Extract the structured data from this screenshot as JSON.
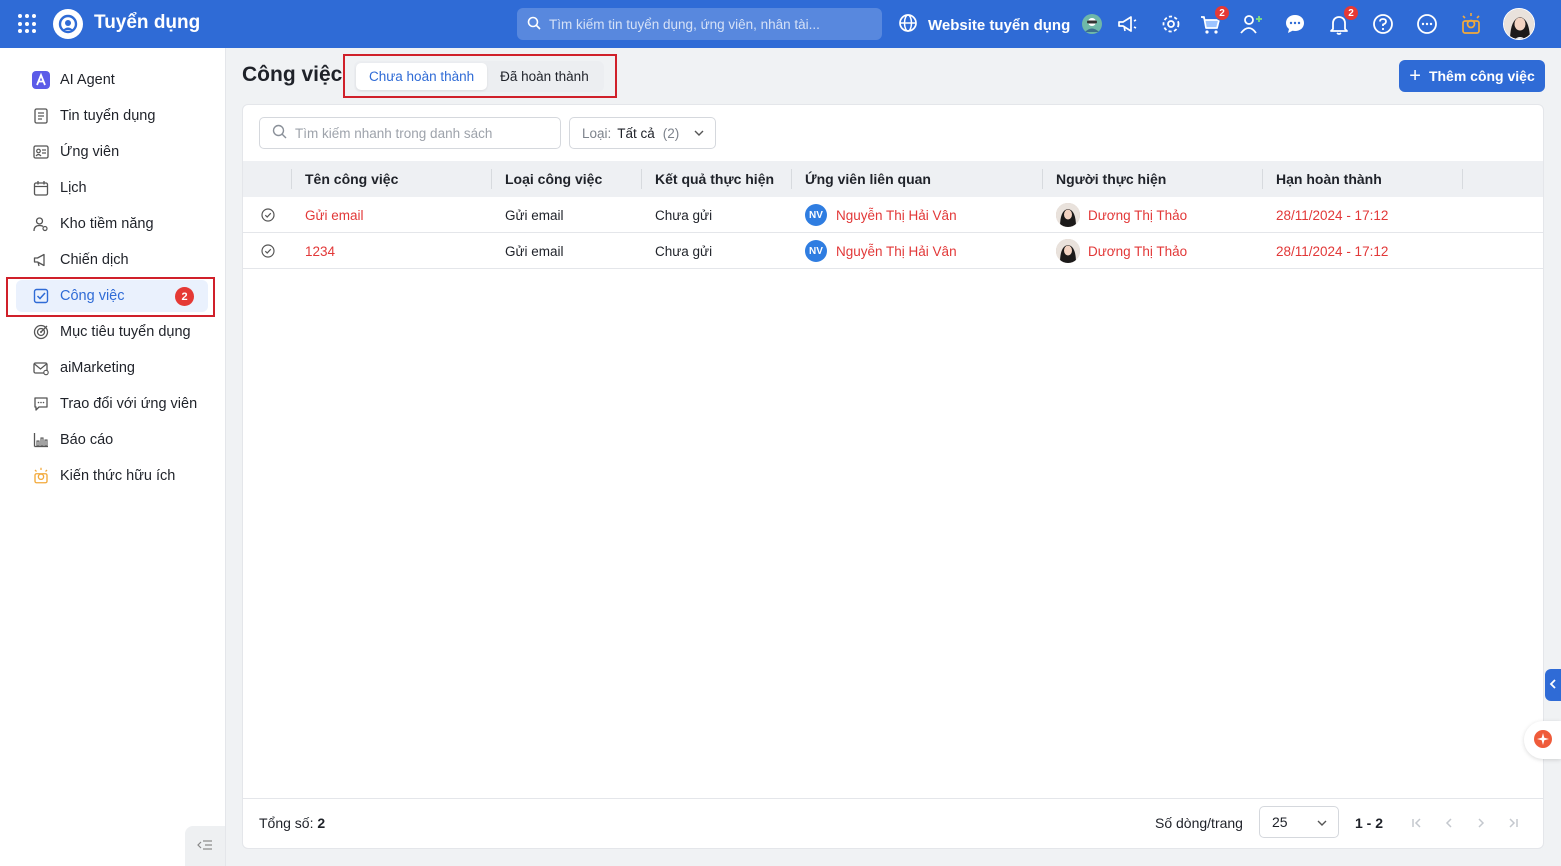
{
  "app": {
    "title": "Tuyển dụng"
  },
  "topbar": {
    "search_placeholder": "Tìm kiếm tin tuyển dụng, ứng viên, nhân tài...",
    "website_label": "Website tuyển dụng",
    "cart_badge": "2",
    "notification_badge": "2"
  },
  "sidebar": {
    "items": [
      {
        "label": "AI Agent"
      },
      {
        "label": "Tin tuyển dụng"
      },
      {
        "label": "Ứng viên"
      },
      {
        "label": "Lịch"
      },
      {
        "label": "Kho tiềm năng"
      },
      {
        "label": "Chiến dịch"
      },
      {
        "label": "Công việc",
        "badge": "2"
      },
      {
        "label": "Mục tiêu tuyển dụng"
      },
      {
        "label": "aiMarketing"
      },
      {
        "label": "Trao đổi với ứng viên"
      },
      {
        "label": "Báo cáo"
      },
      {
        "label": "Kiến thức hữu ích"
      }
    ]
  },
  "page": {
    "title": "Công việc",
    "tabs": [
      {
        "label": "Chưa hoàn thành",
        "active": true
      },
      {
        "label": "Đã hoàn thành",
        "active": false
      }
    ],
    "add_button": "Thêm công việc"
  },
  "list": {
    "search_placeholder": "Tìm kiếm nhanh trong danh sách",
    "filter": {
      "key": "Loại:",
      "value": "Tất cả",
      "count": "(2)"
    },
    "columns": [
      "Tên công việc",
      "Loại công việc",
      "Kết quả thực hiện",
      "Ứng viên liên quan",
      "Người thực hiện",
      "Hạn hoàn thành"
    ],
    "rows": [
      {
        "name": "Gửi email",
        "type": "Gửi email",
        "result": "Chưa gửi",
        "candidate_initials": "NV",
        "candidate": "Nguyễn Thị Hải Vân",
        "assignee": "Dương Thị Thảo",
        "deadline": "28/11/2024 - 17:12"
      },
      {
        "name": "1234",
        "type": "Gửi email",
        "result": "Chưa gửi",
        "candidate_initials": "NV",
        "candidate": "Nguyễn Thị Hải Vân",
        "assignee": "Dương Thị Thảo",
        "deadline": "28/11/2024 - 17:12"
      }
    ]
  },
  "footer": {
    "total_label": "Tổng số:",
    "total_value": "2",
    "rows_per_page_label": "Số dòng/trang",
    "rows_per_page": "25",
    "range": "1 - 2"
  },
  "colors": {
    "primary": "#2f6bd6",
    "danger": "#e23838",
    "highlight": "#d0202a"
  }
}
